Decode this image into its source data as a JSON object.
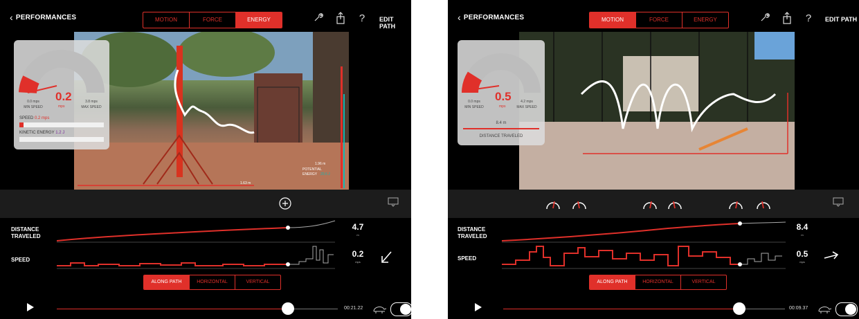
{
  "colors": {
    "accent": "#e0302a",
    "teal": "#19b3b0"
  },
  "left": {
    "back_label": "PERFORMANCES",
    "tabs": [
      {
        "label": "MOTION",
        "active": false
      },
      {
        "label": "FORCE",
        "active": false
      },
      {
        "label": "ENERGY",
        "active": true
      }
    ],
    "edit_label": "EDIT PATH",
    "gauge": {
      "value": "0.2",
      "unit": "mps",
      "min_value": "0.0 mps",
      "min_label": "MIN SPEED",
      "max_value": "3.8 mps",
      "max_label": "MAX SPEED",
      "speed_label": "SPEED",
      "speed_value": "0.2 mps",
      "ke_label": "KINETIC ENERGY",
      "ke_value": "1.2 J"
    },
    "video": {
      "height_value": "1.96 m",
      "pe_label_1": "POTENTIAL",
      "pe_label_2": "ENERGY",
      "pe_value": "20.6 J",
      "distance_overlay": "1.63 m"
    },
    "charts": [
      {
        "label_1": "DISTANCE",
        "label_2": "TRAVELED",
        "value": "4.7",
        "unit": "m"
      },
      {
        "label_1": "SPEED",
        "label_2": "",
        "value": "0.2",
        "unit": "mps"
      }
    ],
    "path_modes": [
      {
        "label": "ALONG PATH",
        "active": true
      },
      {
        "label": "HORIZONTAL",
        "active": false
      },
      {
        "label": "VERTICAL",
        "active": false
      }
    ],
    "time": "00:21.22",
    "playhead_fraction": 0.79
  },
  "right": {
    "back_label": "PERFORMANCES",
    "tabs": [
      {
        "label": "MOTION",
        "active": true
      },
      {
        "label": "FORCE",
        "active": false
      },
      {
        "label": "ENERGY",
        "active": false
      }
    ],
    "edit_label": "EDIT PATH",
    "gauge": {
      "value": "0.5",
      "unit": "mps",
      "min_value": "0.0 mps",
      "min_label": "MIN SPEED",
      "max_value": "4.2 mps",
      "max_label": "MAX SPEED",
      "dist_value": "8.4 m",
      "dist_label": "DISTANCE TRAVELED"
    },
    "charts": [
      {
        "label_1": "DISTANCE",
        "label_2": "TRAVELED",
        "value": "8.4",
        "unit": "m"
      },
      {
        "label_1": "SPEED",
        "label_2": "",
        "value": "0.5",
        "unit": "mps"
      }
    ],
    "path_modes": [
      {
        "label": "ALONG PATH",
        "active": true
      },
      {
        "label": "HORIZONTAL",
        "active": false
      },
      {
        "label": "VERTICAL",
        "active": false
      }
    ],
    "time": "00:09.37",
    "playhead_fraction": 0.84
  }
}
